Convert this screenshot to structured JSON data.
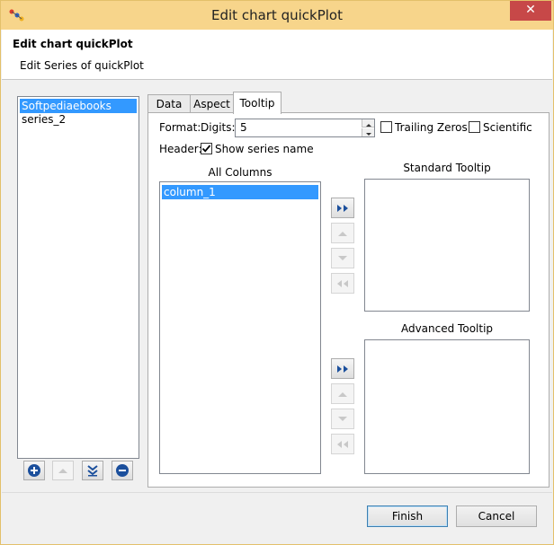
{
  "window": {
    "title": "Edit chart quickPlot",
    "close_glyph": "✕"
  },
  "header": {
    "title": "Edit chart quickPlot",
    "subtitle": "Edit Series of quickPlot"
  },
  "series_list": {
    "items": [
      {
        "label": "Softpediaebooks",
        "selected": true
      },
      {
        "label": "series_2",
        "selected": false
      }
    ]
  },
  "series_buttons": [
    {
      "name": "add-series-button",
      "icon": "plus-circle-icon",
      "enabled": true
    },
    {
      "name": "move-series-up-button",
      "icon": "up-triangle-icon",
      "enabled": false
    },
    {
      "name": "move-series-down-button",
      "icon": "double-down-icon",
      "enabled": true
    },
    {
      "name": "remove-series-button",
      "icon": "minus-circle-icon",
      "enabled": true
    }
  ],
  "tabs": [
    {
      "label": "Data",
      "active": false
    },
    {
      "label": "Aspect",
      "active": false
    },
    {
      "label": "Tooltip",
      "active": true
    }
  ],
  "tooltip": {
    "format_label": "Format:",
    "digits_label": "Digits:",
    "digits_value": "5",
    "trailing_zeros_label": "Trailing Zeros",
    "trailing_zeros_checked": false,
    "scientific_label": "Scientific",
    "scientific_checked": false,
    "header_label": "Header:",
    "show_series_name_label": "Show series name",
    "show_series_name_checked": true,
    "all_columns_label": "All Columns",
    "all_columns": [
      "column_1"
    ],
    "standard_tooltip_label": "Standard Tooltip",
    "advanced_tooltip_label": "Advanced Tooltip"
  },
  "footer": {
    "finish_label": "Finish",
    "cancel_label": "Cancel"
  },
  "colors": {
    "titlebar": "#f7d58b",
    "selection": "#3399ff",
    "icon_blue": "#1b4f9c"
  }
}
